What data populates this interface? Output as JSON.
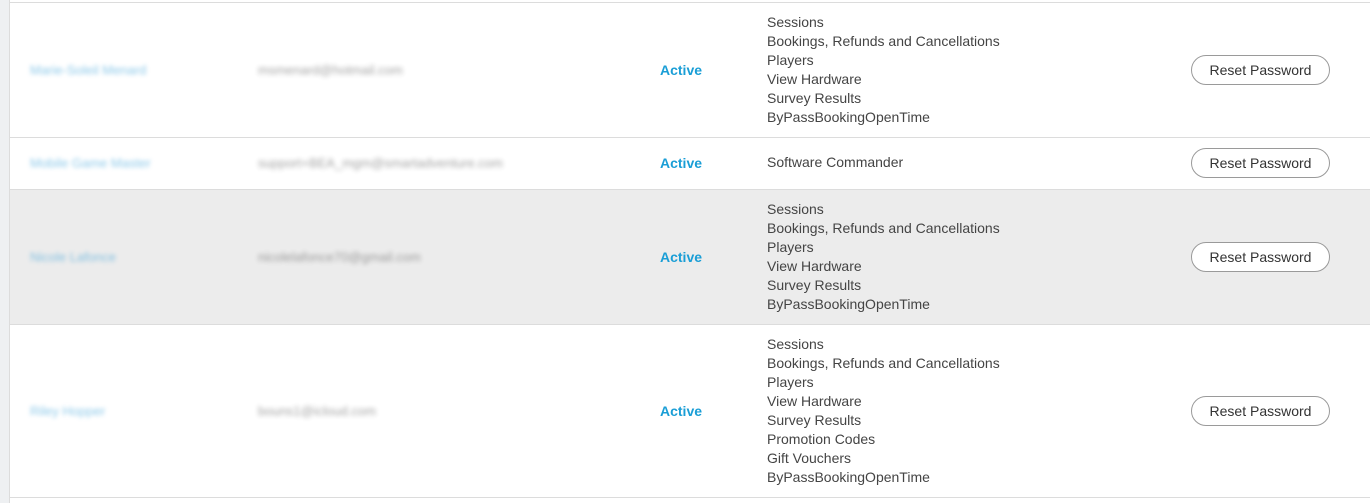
{
  "users": [
    {
      "name": "Marie-Soleil Menard",
      "email": "msmenard@hotmail.com",
      "status": "Active",
      "permissions": [
        "Sessions",
        "Bookings, Refunds and Cancellations",
        "Players",
        "View Hardware",
        "Survey Results",
        "ByPassBookingOpenTime"
      ],
      "action": "Reset Password"
    },
    {
      "name": "Mobile Game Master",
      "email": "support+BEA_mgm@smartadventure.com",
      "status": "Active",
      "permissions": [
        "Software Commander"
      ],
      "action": "Reset Password"
    },
    {
      "name": "Nicole Lafonce",
      "email": "nicolelafonce70@gmail.com",
      "status": "Active",
      "permissions": [
        "Sessions",
        "Bookings, Refunds and Cancellations",
        "Players",
        "View Hardware",
        "Survey Results",
        "ByPassBookingOpenTime"
      ],
      "action": "Reset Password"
    },
    {
      "name": "Riley Hopper",
      "email": "bouns1@icloud.com",
      "status": "Active",
      "permissions": [
        "Sessions",
        "Bookings, Refunds and Cancellations",
        "Players",
        "View Hardware",
        "Survey Results",
        "Promotion Codes",
        "Gift Vouchers",
        "ByPassBookingOpenTime"
      ],
      "action": "Reset Password"
    }
  ]
}
